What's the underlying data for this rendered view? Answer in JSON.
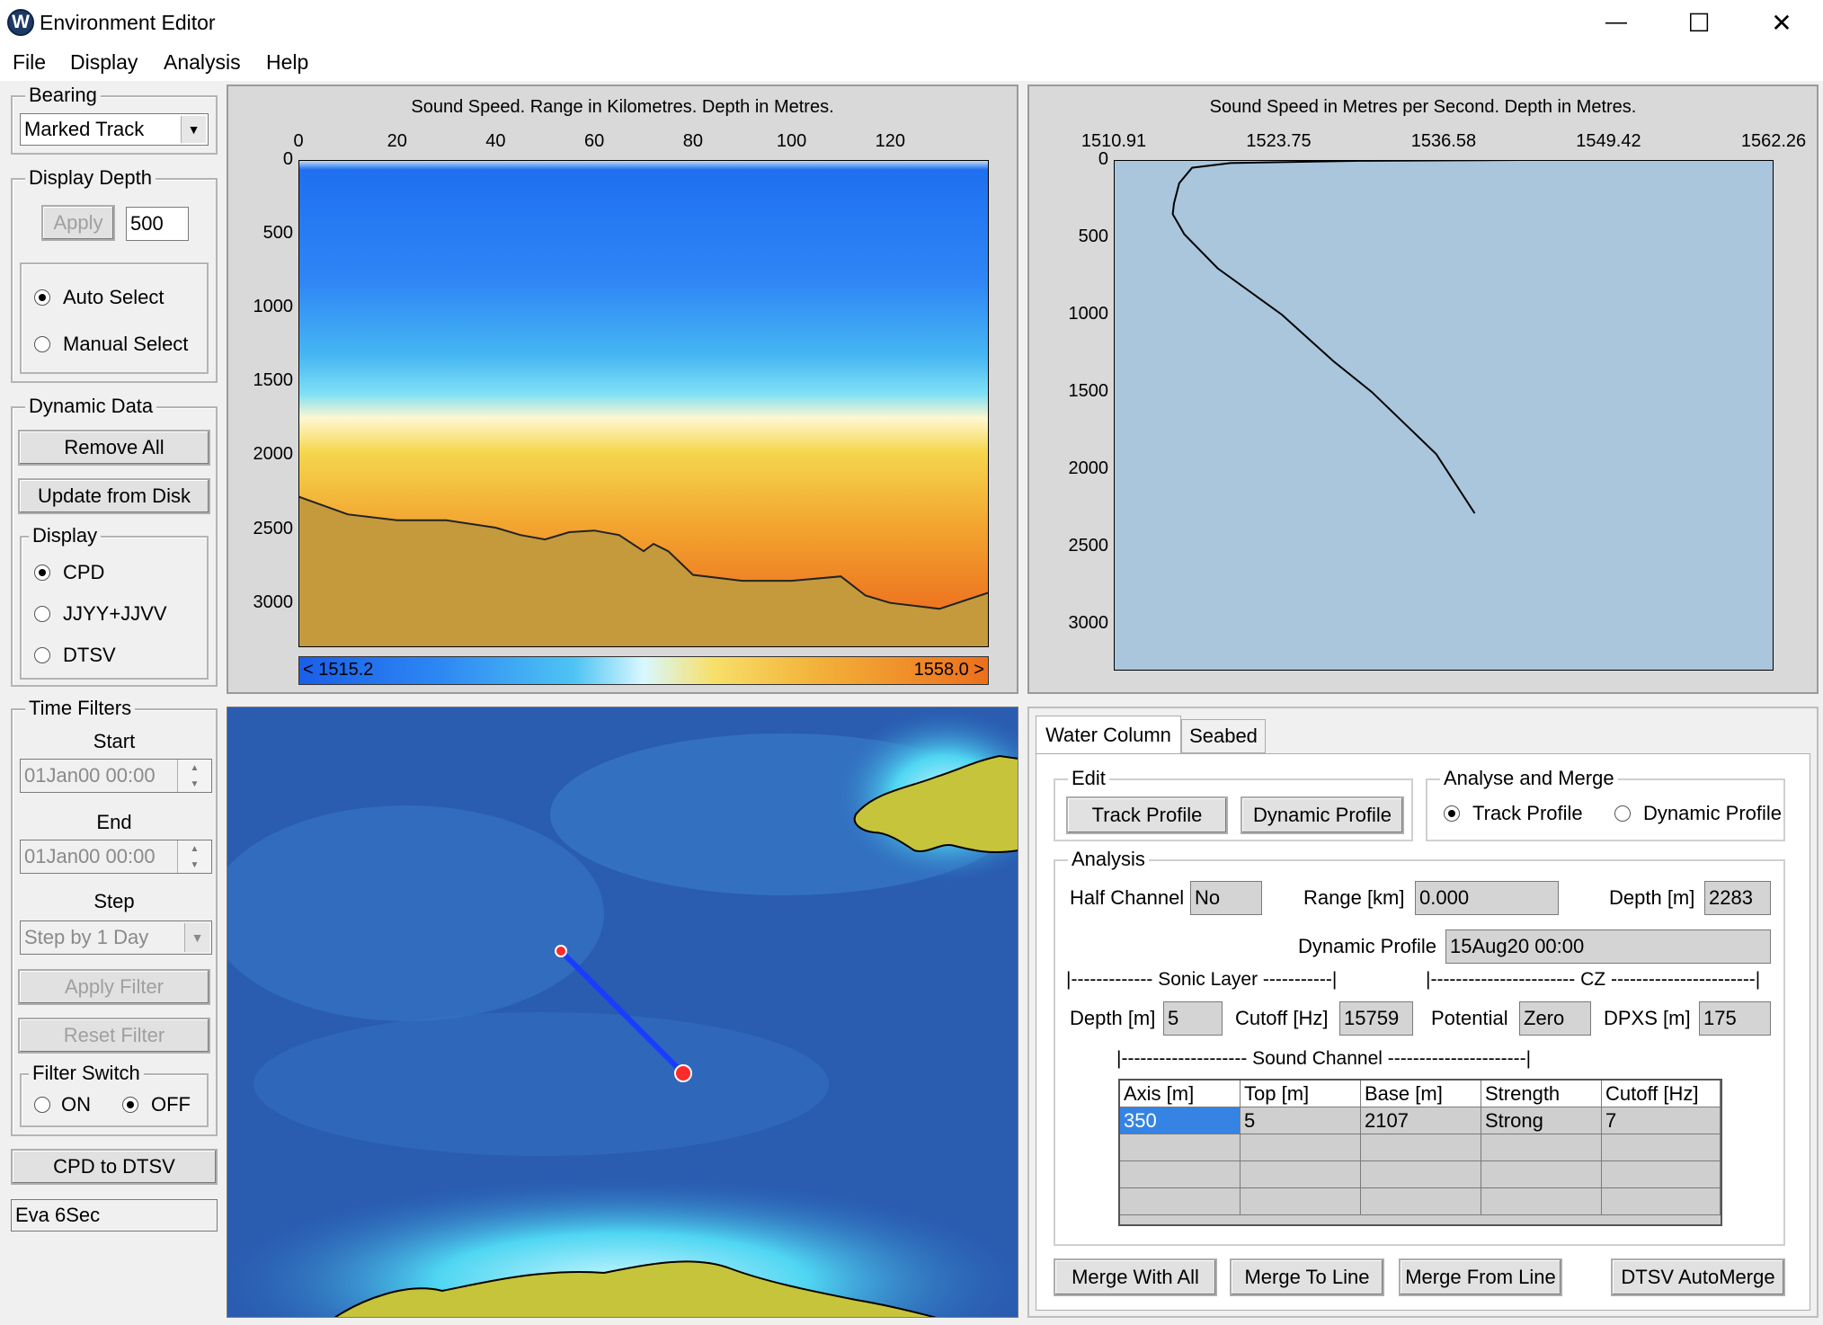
{
  "window": {
    "title": "Environment Editor",
    "app_letter": "W",
    "minimize": "—",
    "maximize": "☐",
    "close": "✕"
  },
  "menu": [
    "File",
    "Display",
    "Analysis",
    "Help"
  ],
  "left": {
    "bearing": {
      "legend": "Bearing",
      "value": "Marked Track"
    },
    "display_depth": {
      "legend": "Display Depth",
      "apply": "Apply",
      "value": "500",
      "auto": "Auto Select",
      "manual": "Manual Select"
    },
    "dynamic": {
      "legend": "Dynamic Data",
      "remove_all": "Remove All",
      "update": "Update from Disk"
    },
    "display": {
      "legend": "Display",
      "cpd": "CPD",
      "jjyy": "JJYY+JJVV",
      "dtsv": "DTSV"
    },
    "time_filters": {
      "legend": "Time Filters",
      "start_label": "Start",
      "start_value": "01Jan00 00:00",
      "end_label": "End",
      "end_value": "01Jan00 00:00",
      "step_label": "Step",
      "step_value": "Step by 1 Day",
      "apply": "Apply Filter",
      "reset": "Reset Filter",
      "switch_legend": "Filter Switch",
      "on": "ON",
      "off": "OFF"
    },
    "cpd_to_dtsv": "CPD to DTSV",
    "status": "Eva 6Sec"
  },
  "section_plot": {
    "title": "Sound Speed. Range in Kilometres. Depth in Metres.",
    "x_ticks": [
      "0",
      "20",
      "40",
      "60",
      "80",
      "100",
      "120"
    ],
    "y_ticks": [
      "0",
      "500",
      "1000",
      "1500",
      "2000",
      "2500",
      "3000"
    ],
    "colorbar_min": "< 1515.2",
    "colorbar_max": "1558.0 >"
  },
  "profile_plot": {
    "title": "Sound Speed in Metres per Second. Depth in Metres.",
    "x_ticks": [
      "1510.91",
      "1523.75",
      "1536.58",
      "1549.42",
      "1562.26"
    ],
    "y_ticks": [
      "0",
      "500",
      "1000",
      "1500",
      "2000",
      "2500",
      "3000"
    ]
  },
  "chart_data": [
    {
      "type": "line",
      "title": "Sound Speed in Metres per Second. Depth in Metres.",
      "xlim": [
        1510.91,
        1562.26
      ],
      "ylim": [
        0,
        3300
      ],
      "x": [
        1542.5,
        1530,
        1520,
        1517,
        1516,
        1515.6,
        1515.5,
        1516.4,
        1519,
        1524,
        1528,
        1531,
        1536,
        1539
      ],
      "y": [
        0,
        5,
        20,
        50,
        150,
        280,
        350,
        480,
        700,
        1000,
        1300,
        1500,
        1900,
        2283
      ],
      "series": [
        {
          "values": [
            0,
            5,
            20,
            50,
            150,
            280,
            350,
            480,
            700,
            1000,
            1300,
            1500,
            1900,
            2283
          ]
        }
      ]
    }
  ],
  "seabed_profile": {
    "range_km": [
      0,
      10,
      20,
      30,
      40,
      45,
      50,
      55,
      60,
      65,
      70,
      72,
      75,
      80,
      90,
      100,
      110,
      115,
      120,
      130,
      140
    ],
    "depth_m": [
      2280,
      2400,
      2440,
      2440,
      2490,
      2540,
      2570,
      2520,
      2510,
      2540,
      2650,
      2600,
      2650,
      2810,
      2850,
      2850,
      2820,
      2950,
      3000,
      3040,
      2930
    ]
  },
  "tabs": {
    "water_column": "Water Column",
    "seabed": "Seabed"
  },
  "edit": {
    "legend": "Edit",
    "track": "Track Profile",
    "dynamic": "Dynamic Profile"
  },
  "analyse": {
    "legend": "Analyse and Merge",
    "track": "Track Profile",
    "dynamic": "Dynamic Profile"
  },
  "analysis": {
    "legend": "Analysis",
    "half_channel_label": "Half Channel",
    "half_channel": "No",
    "range_label": "Range [km]",
    "range": "0.000",
    "depth_label": "Depth [m]",
    "depth": "2283",
    "dyn_profile_label": "Dynamic Profile",
    "dyn_profile": "15Aug20 00:00",
    "sonic_layer_header": "|------------- Sonic Layer -----------|",
    "cz_header": "|----------------------- CZ -----------------------|",
    "sl_depth_label": "Depth [m]",
    "sl_depth": "5",
    "cutoff_label": "Cutoff [Hz]",
    "cutoff": "15759",
    "potential_label": "Potential",
    "potential": "Zero",
    "dpxs_label": "DPXS [m]",
    "dpxs": "175",
    "sound_channel_header": "|-------------------- Sound Channel ----------------------|",
    "table_headers": [
      "Axis [m]",
      "Top [m]",
      "Base [m]",
      "Strength",
      "Cutoff [Hz]"
    ],
    "table_rows": [
      [
        "350",
        "5",
        "2107",
        "Strong",
        "7"
      ]
    ]
  },
  "merge_buttons": {
    "all": "Merge With All",
    "to_line": "Merge To Line",
    "from_line": "Merge From Line",
    "auto": "DTSV AutoMerge"
  },
  "colors": {
    "selection": "#3584e4",
    "plot_bg": "#a9c6dc",
    "seabed": "#c49a3c",
    "track": "#1a3cff"
  }
}
